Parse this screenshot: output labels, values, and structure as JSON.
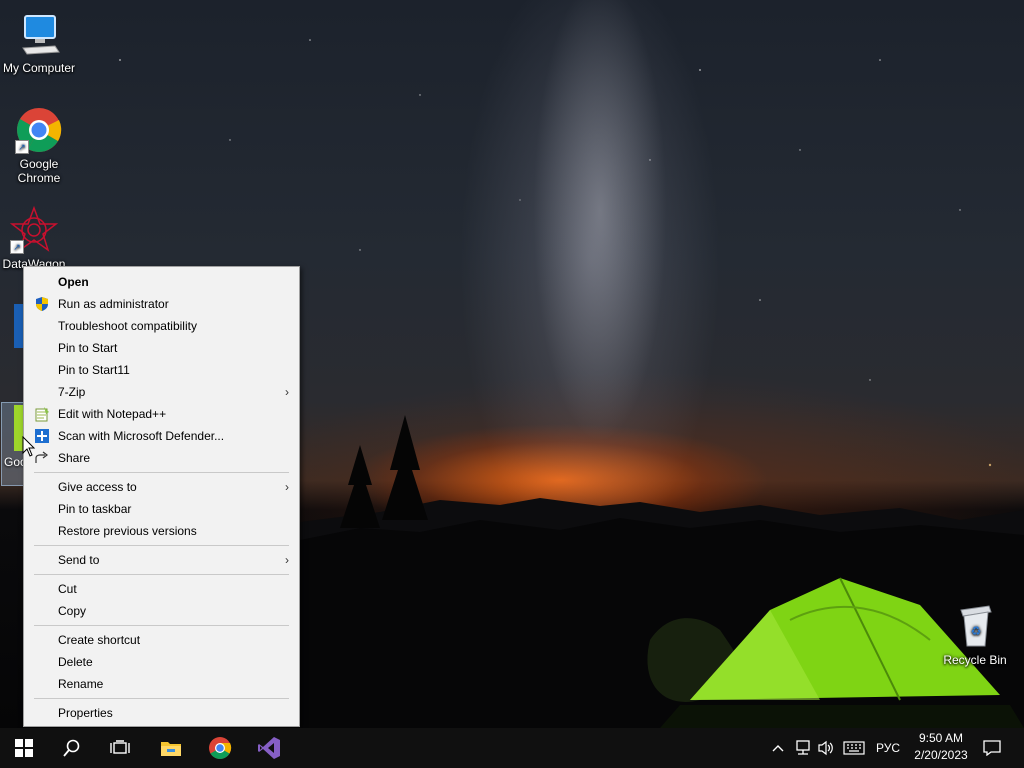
{
  "desktop": {
    "icons": [
      {
        "label_line1": "My Computer",
        "label_line2": ""
      },
      {
        "label_line1": "Google",
        "label_line2": "Chrome"
      },
      {
        "label_line1": "DataWagon",
        "label_line2": ""
      },
      {
        "label_line1": "Recycle Bin",
        "label_line2": ""
      }
    ],
    "selected_icon_label": "Goo"
  },
  "context_menu": {
    "items": [
      {
        "label": "Open"
      },
      {
        "label": "Run as administrator",
        "icon": "uac-shield-icon"
      },
      {
        "label": "Troubleshoot compatibility"
      },
      {
        "label": "Pin to Start"
      },
      {
        "label": "Pin to Start11"
      },
      {
        "label": "7-Zip",
        "submenu": true
      },
      {
        "label": "Edit with Notepad++",
        "icon": "notepadpp-icon"
      },
      {
        "label": "Scan with Microsoft Defender...",
        "icon": "defender-icon"
      },
      {
        "label": "Share",
        "icon": "share-icon"
      },
      {
        "label": "Give access to",
        "submenu": true
      },
      {
        "label": "Pin to taskbar"
      },
      {
        "label": "Restore previous versions"
      },
      {
        "label": "Send to",
        "submenu": true
      },
      {
        "label": "Cut"
      },
      {
        "label": "Copy"
      },
      {
        "label": "Create shortcut"
      },
      {
        "label": "Delete"
      },
      {
        "label": "Rename"
      },
      {
        "label": "Properties"
      }
    ],
    "submenu_arrow": "›"
  },
  "taskbar": {
    "pinned": [
      "start-windows-icon",
      "search-icon",
      "task-view-icon",
      "file-explorer-icon",
      "chrome-icon",
      "visual-studio-icon"
    ],
    "tray": {
      "language": "РУС",
      "time": "9:50 AM",
      "date": "2/20/2023"
    }
  },
  "colors": {
    "menu_bg": "#f2f2f2",
    "taskbar_bg": "#101010",
    "tent_green": "#7fd414"
  }
}
